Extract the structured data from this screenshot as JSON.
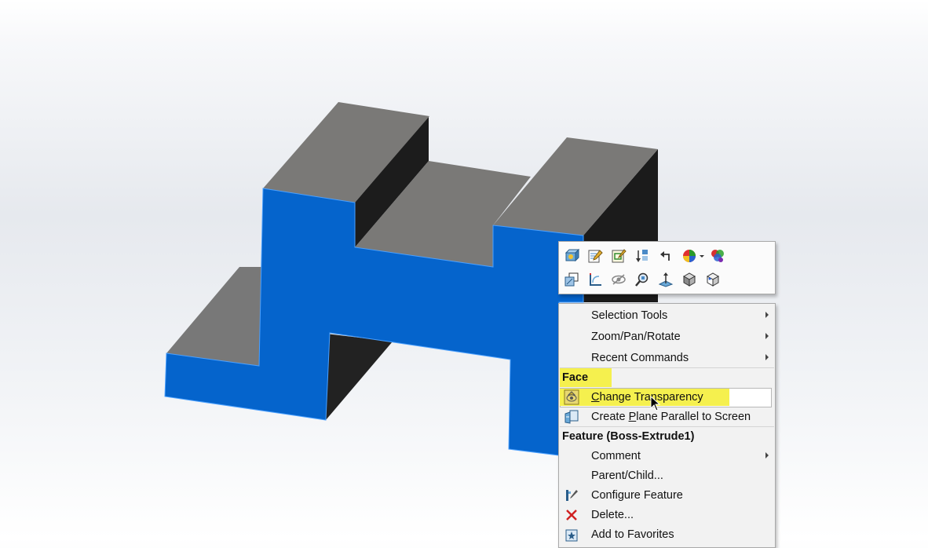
{
  "toolbar": {
    "row1": [
      {
        "icon": "edit-sketch-plane-icon"
      },
      {
        "icon": "edit-feature-icon"
      },
      {
        "icon": "edit-sketch-icon"
      },
      {
        "icon": "rollback-icon"
      },
      {
        "icon": "parent-select-icon"
      },
      {
        "icon": "appearance-icon"
      },
      {
        "icon": "dropdown-arrow-icon"
      },
      {
        "icon": "appearances-multi-icon"
      }
    ],
    "row2": [
      {
        "icon": "copy-face-icon"
      },
      {
        "icon": "sketch-on-face-icon"
      },
      {
        "icon": "hide-icon"
      },
      {
        "icon": "zoom-to-selection-icon"
      },
      {
        "icon": "normal-to-icon"
      },
      {
        "icon": "view-cube-icon"
      },
      {
        "icon": "view-cube-alt-icon"
      }
    ]
  },
  "menu": {
    "selection_tools": "Selection Tools",
    "zoom_pan_rotate": "Zoom/Pan/Rotate",
    "recent_commands": "Recent Commands",
    "face_header": "Face",
    "change_transparency": {
      "pre": "",
      "u": "C",
      "post": "hange Transparency"
    },
    "create_plane": {
      "pre": "Create ",
      "u": "P",
      "post": "lane Parallel to Screen"
    },
    "feature_header": "Feature (Boss-Extrude1)",
    "comment": "Comment",
    "parent_child": "Parent/Child...",
    "configure_feature": "Configure Feature",
    "delete": "Delete...",
    "add_to_favorites": "Add to Favorites"
  },
  "colors": {
    "face_blue": "#0564cc",
    "top_gray": "#787878",
    "side_black": "#1c1c1c",
    "highlight_yellow": "#f5f04e"
  }
}
